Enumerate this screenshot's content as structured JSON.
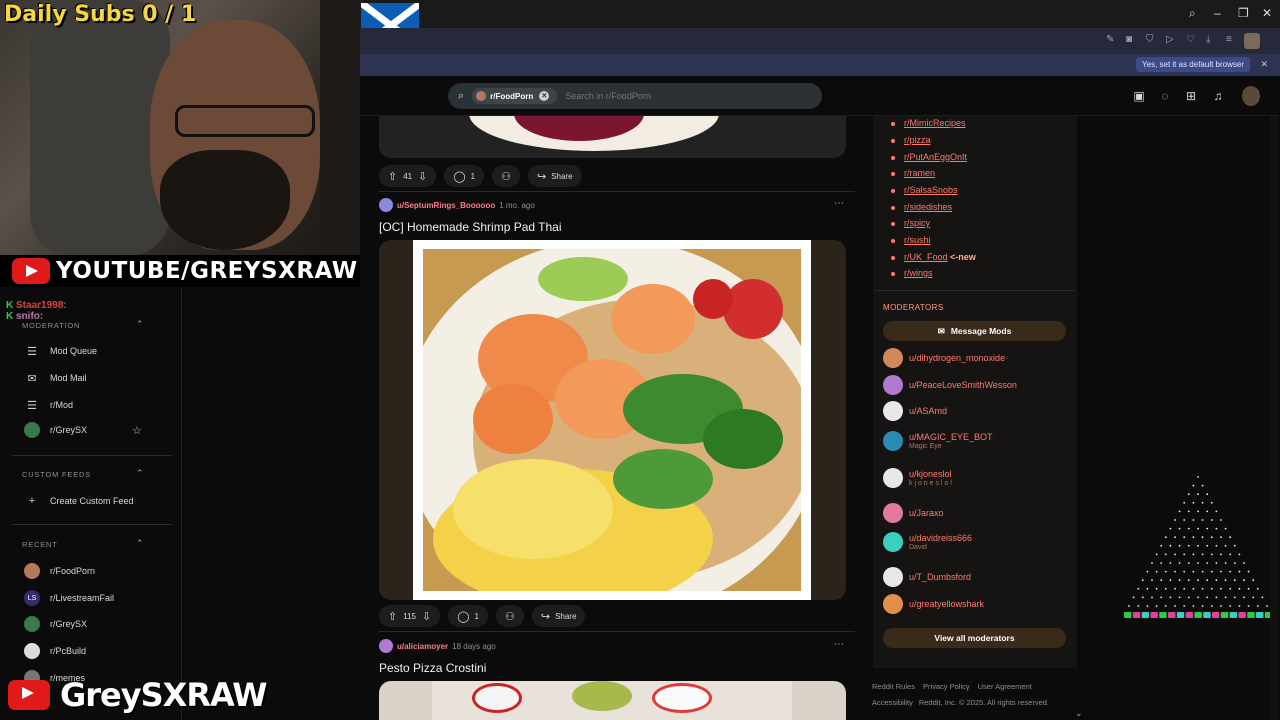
{
  "overlay": {
    "subs": "Daily Subs  0 / 1",
    "youtube_banner": "YOUTUBE/GREYSXRAW",
    "bottom_channel": "GreySXRAW",
    "chat_lines": [
      "Staar1998:",
      "snifo:"
    ]
  },
  "browser": {
    "default_prompt": "Yes, set it as default browser"
  },
  "search": {
    "chip": "r/FoodPorn",
    "placeholder": "Search in r/FoodPorn"
  },
  "left_sidebar": {
    "moderation_head": "MODERATION",
    "moderation_items": [
      "Mod Queue",
      "Mod Mail",
      "r/Mod",
      "r/GreySX"
    ],
    "custom_feeds_head": "CUSTOM FEEDS",
    "create_feed": "Create Custom Feed",
    "recent_head": "RECENT",
    "recent_items": [
      "r/FoodPorn",
      "r/LivestreamFail",
      "r/GreySX",
      "r/PcBuild",
      "r/memes"
    ]
  },
  "posts": {
    "first": {
      "votes": "41",
      "comments": "1",
      "share": "Share"
    },
    "second": {
      "user": "u/SeptumRings_Boooooo",
      "time": "1 mo. ago",
      "title": "[OC] Homemade Shrimp Pad Thai",
      "votes": "115",
      "comments": "1",
      "share": "Share"
    },
    "third": {
      "user": "u/aliciamoyer",
      "time": "18 days ago",
      "title": "Pesto Pizza Crostini"
    }
  },
  "right_sidebar": {
    "subs": [
      "r/MimicRecipes",
      "r/pizza",
      "r/PutAnEggOnIt",
      "r/ramen",
      "r/SalsaSnobs",
      "r/sidedishes",
      "r/spicy",
      "r/sushi",
      "r/UK_Food",
      "r/wings"
    ],
    "new_tag": "<-new",
    "moderators_head": "MODERATORS",
    "message_mods": "Message Mods",
    "mods": [
      {
        "name": "u/dihydrogen_monoxide",
        "flair": ""
      },
      {
        "name": "u/PeaceLoveSmithWesson",
        "flair": ""
      },
      {
        "name": "u/ASAmd",
        "flair": ""
      },
      {
        "name": "u/MAGIC_EYE_BOT",
        "flair": "Magic Eye"
      },
      {
        "name": "u/kjoneslol",
        "flair": "k j o n e s l o l"
      },
      {
        "name": "u/Jaraxo",
        "flair": ""
      },
      {
        "name": "u/davidreiss666",
        "flair": "David"
      },
      {
        "name": "u/T_Dumbsford",
        "flair": ""
      },
      {
        "name": "u/greatyellowshark",
        "flair": ""
      }
    ],
    "view_all": "View all moderators",
    "footer": [
      "Reddit Rules",
      "Privacy Policy",
      "User Agreement",
      "Accessibility",
      "Reddit, Inc. © 2025. All rights reserved."
    ]
  },
  "colors": {
    "accent": "#ff7b6b",
    "youtube": "#e01919",
    "subs": "#f5d742"
  }
}
